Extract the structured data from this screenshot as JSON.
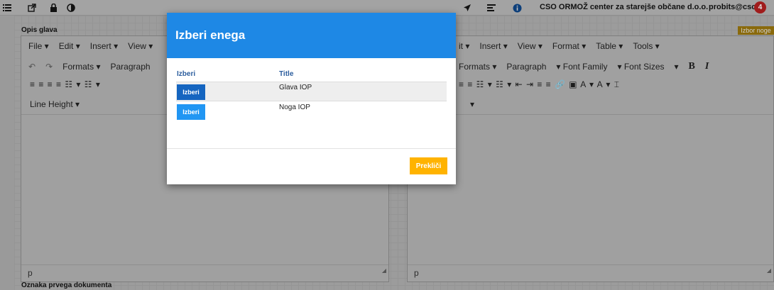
{
  "topbar": {
    "icons": [
      "list-icon",
      "external-link-icon",
      "lock-icon",
      "contrast-icon",
      "send-icon",
      "tasks-icon",
      "info-icon"
    ],
    "organization": "CSO ORMOŽ center za starejše občane d.o.o.",
    "user": "probits@cso",
    "badge": "4"
  },
  "page": {
    "section_top": "Opis glava",
    "section_bottom": "Oznaka prvega dokumenta",
    "izbor_noge": "Izbor noge"
  },
  "editor_left": {
    "menu": [
      "File ▾",
      "Edit ▾",
      "Insert ▾",
      "View ▾"
    ],
    "row2": [
      "Formats ▾",
      "Paragraph"
    ],
    "row3": "≡ ≡ ≡ ≡ ☷ ▾ ☷ ▾",
    "row4": "Line Height ▾",
    "status": "p"
  },
  "editor_right": {
    "menu": [
      "it ▾",
      "Insert ▾",
      "View ▾",
      "Format ▾",
      "Table ▾",
      "Tools ▾"
    ],
    "row2": [
      "Formats ▾",
      "Paragraph",
      "▾  Font Family",
      "▾  Font Sizes",
      "▾"
    ],
    "row2_bold": "B",
    "row2_italic": "I",
    "row3": "≡ ≡ ☷ ▾ ☷ ▾ ⇤ ⇥ ≡ ≡ 🔗 ▣ A ▾ A ▾ ⌶",
    "row4": "▾",
    "status": "p"
  },
  "modal": {
    "title": "Izberi enega",
    "col_select": "Izberi",
    "col_title": "Title",
    "rows": [
      {
        "button": "Izberi",
        "title": "Glava IOP"
      },
      {
        "button": "Izberi",
        "title": "Noga IOP"
      }
    ],
    "cancel": "Prekliči"
  },
  "colors": {
    "modal_header": "#1e88e5",
    "select_dark": "#1565c0",
    "select_light": "#2196f3",
    "cancel": "#ffb300",
    "badge": "#a01c1c"
  }
}
